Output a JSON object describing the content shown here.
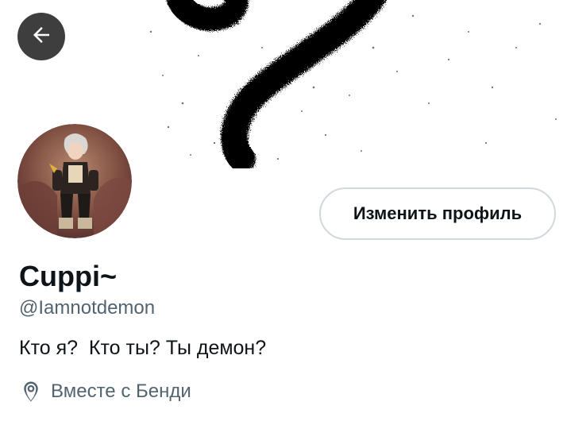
{
  "banner": {
    "description_icon": "spray-paint-banner"
  },
  "nav": {
    "back_icon": "arrow-left-icon"
  },
  "profile": {
    "display_name": "Cuppi~",
    "handle": "@Iamnotdemon",
    "bio": "Кто я?  Кто ты? Ты демон?",
    "location_icon": "map-pin-icon",
    "location": "Вместе с Бенди",
    "edit_button_label": "Изменить профиль"
  },
  "colors": {
    "text_primary": "#0f1419",
    "text_secondary": "#536471",
    "button_border": "#cfd9de",
    "back_button_bg": "#1c1c1c"
  }
}
